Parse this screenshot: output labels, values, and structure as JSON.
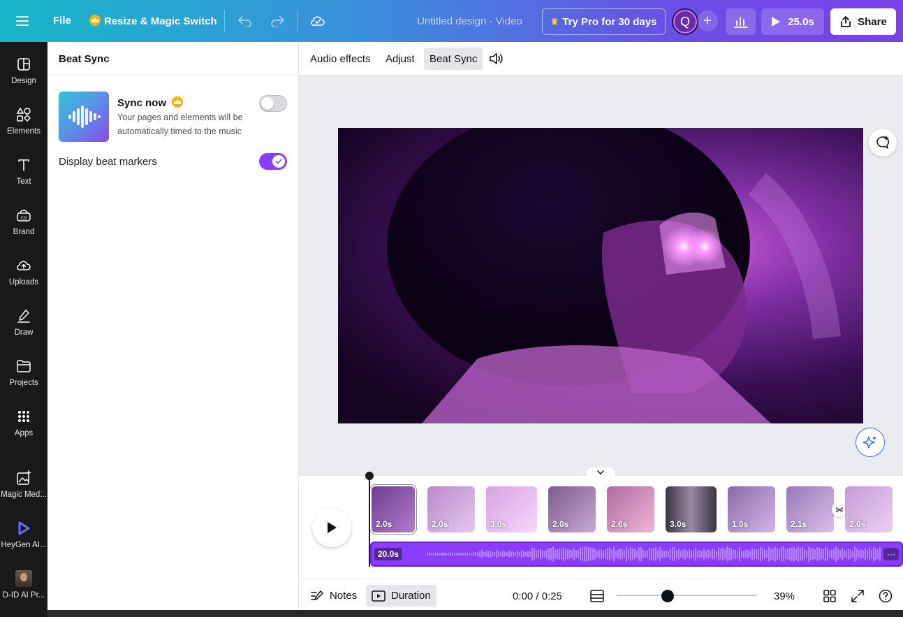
{
  "topbar": {
    "file_label": "File",
    "resize_label": "Resize & Magic Switch",
    "title": "Untitled design - Video",
    "pro_label": "Try Pro for 30 days",
    "avatar_initial": "Q",
    "play_duration": "25.0s",
    "share_label": "Share"
  },
  "rail": {
    "items": [
      {
        "label": "Design",
        "icon": "design-icon"
      },
      {
        "label": "Elements",
        "icon": "elements-icon"
      },
      {
        "label": "Text",
        "icon": "text-icon"
      },
      {
        "label": "Brand",
        "icon": "brand-icon"
      },
      {
        "label": "Uploads",
        "icon": "uploads-icon"
      },
      {
        "label": "Draw",
        "icon": "draw-icon"
      },
      {
        "label": "Projects",
        "icon": "projects-icon"
      },
      {
        "label": "Apps",
        "icon": "apps-icon"
      },
      {
        "label": "Magic Med...",
        "icon": "magic-media-icon"
      },
      {
        "label": "HeyGen AI...",
        "icon": "heygen-icon"
      },
      {
        "label": "D-ID AI Pr...",
        "icon": "did-icon"
      }
    ]
  },
  "panel": {
    "title": "Beat Sync",
    "sync_title": "Sync now",
    "sync_desc": "Your pages and elements will be automatically timed to the music",
    "sync_enabled": false,
    "beat_markers_label": "Display beat markers",
    "beat_markers_enabled": true
  },
  "context_bar": {
    "tabs": [
      "Audio effects",
      "Adjust",
      "Beat Sync"
    ],
    "active_tab": "Beat Sync"
  },
  "timeline": {
    "clips": [
      "2.0s",
      "2.0s",
      "3.0s",
      "2.0s",
      "2.6s",
      "3.0s",
      "1.0s",
      "2.1s",
      "2.0s"
    ],
    "audio_duration": "20.0s",
    "audio_more": "···"
  },
  "bottombar": {
    "notes_label": "Notes",
    "duration_label": "Duration",
    "time": "0:00 / 0:25",
    "zoom_fraction": 0.39,
    "zoom_pct": "39%"
  },
  "colors": {
    "accent": "#8b3dff",
    "topbar_start": "#17b8c9",
    "topbar_end": "#7b3fe8",
    "rail_bg": "#18191b"
  }
}
